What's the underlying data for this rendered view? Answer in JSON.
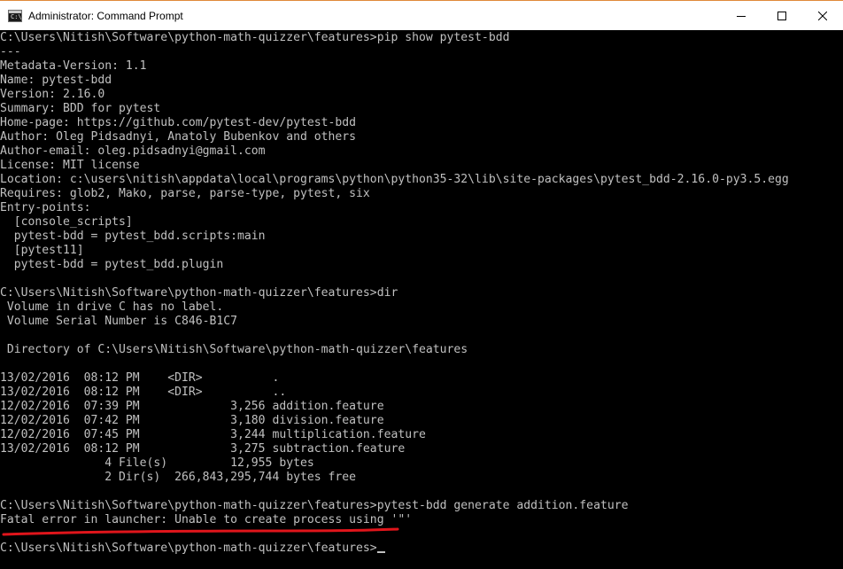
{
  "window": {
    "title": "Administrator: Command Prompt",
    "icon_label": "C:\\",
    "icon": "command-prompt-icon",
    "controls": [
      "minimize-icon",
      "maximize-icon",
      "close-icon"
    ]
  },
  "console": {
    "lines": [
      "C:\\Users\\Nitish\\Software\\python-math-quizzer\\features>pip show pytest-bdd",
      "---",
      "Metadata-Version: 1.1",
      "Name: pytest-bdd",
      "Version: 2.16.0",
      "Summary: BDD for pytest",
      "Home-page: https://github.com/pytest-dev/pytest-bdd",
      "Author: Oleg Pidsadnyi, Anatoly Bubenkov and others",
      "Author-email: oleg.pidsadnyi@gmail.com",
      "License: MIT license",
      "Location: c:\\users\\nitish\\appdata\\local\\programs\\python\\python35-32\\lib\\site-packages\\pytest_bdd-2.16.0-py3.5.egg",
      "Requires: glob2, Mako, parse, parse-type, pytest, six",
      "Entry-points:",
      "  [console_scripts]",
      "  pytest-bdd = pytest_bdd.scripts:main",
      "  [pytest11]",
      "  pytest-bdd = pytest_bdd.plugin",
      "",
      "C:\\Users\\Nitish\\Software\\python-math-quizzer\\features>dir",
      " Volume in drive C has no label.",
      " Volume Serial Number is C846-B1C7",
      "",
      " Directory of C:\\Users\\Nitish\\Software\\python-math-quizzer\\features",
      "",
      "13/02/2016  08:12 PM    <DIR>          .",
      "13/02/2016  08:12 PM    <DIR>          ..",
      "12/02/2016  07:39 PM             3,256 addition.feature",
      "12/02/2016  07:42 PM             3,180 division.feature",
      "12/02/2016  07:45 PM             3,244 multiplication.feature",
      "13/02/2016  08:12 PM             3,275 subtraction.feature",
      "               4 File(s)         12,955 bytes",
      "               2 Dir(s)  266,843,295,744 bytes free",
      "",
      "C:\\Users\\Nitish\\Software\\python-math-quizzer\\features>pytest-bdd generate addition.feature",
      "Fatal error in launcher: Unable to create process using '\"'",
      ""
    ],
    "prompt": "C:\\Users\\Nitish\\Software\\python-math-quizzer\\features>"
  },
  "colors": {
    "console_background": "#000000",
    "console_text": "#c0c0c0",
    "annotation": "#e0151b",
    "titlebar_border": "#e08a3a"
  }
}
